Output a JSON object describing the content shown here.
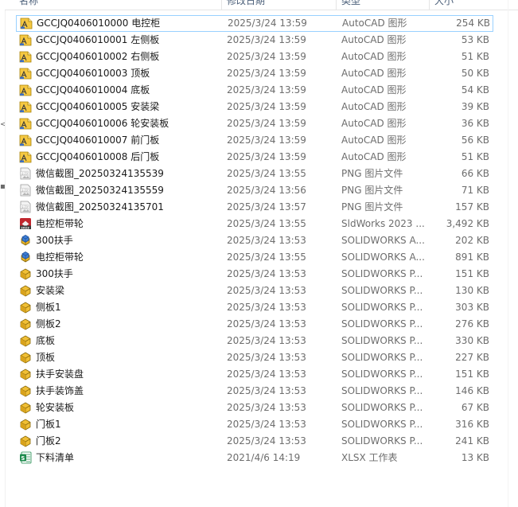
{
  "header": {
    "name": "名称",
    "date": "修改日期",
    "type": "类型",
    "size": "大小"
  },
  "nav_glyphs": [
    {
      "symbol": "<"
    },
    {
      "symbol": "▪"
    }
  ],
  "files": [
    {
      "name": "GCCJQ0406010000 电控柜",
      "date": "2025/3/24 13:59",
      "type": "AutoCAD 图形",
      "size": "254 KB",
      "icon": "dwg-file-icon",
      "selected": true
    },
    {
      "name": "GCCJQ0406010001 左侧板",
      "date": "2025/3/24 13:59",
      "type": "AutoCAD 图形",
      "size": "53 KB",
      "icon": "dwg-file-icon"
    },
    {
      "name": "GCCJQ0406010002 右侧板",
      "date": "2025/3/24 13:59",
      "type": "AutoCAD 图形",
      "size": "51 KB",
      "icon": "dwg-file-icon"
    },
    {
      "name": "GCCJQ0406010003 顶板",
      "date": "2025/3/24 13:59",
      "type": "AutoCAD 图形",
      "size": "50 KB",
      "icon": "dwg-file-icon"
    },
    {
      "name": "GCCJQ0406010004 底板",
      "date": "2025/3/24 13:59",
      "type": "AutoCAD 图形",
      "size": "54 KB",
      "icon": "dwg-file-icon"
    },
    {
      "name": "GCCJQ0406010005 安装梁",
      "date": "2025/3/24 13:59",
      "type": "AutoCAD 图形",
      "size": "39 KB",
      "icon": "dwg-file-icon"
    },
    {
      "name": "GCCJQ0406010006 轮安装板",
      "date": "2025/3/24 13:59",
      "type": "AutoCAD 图形",
      "size": "36 KB",
      "icon": "dwg-file-icon"
    },
    {
      "name": "GCCJQ0406010007 前门板",
      "date": "2025/3/24 13:59",
      "type": "AutoCAD 图形",
      "size": "56 KB",
      "icon": "dwg-file-icon"
    },
    {
      "name": "GCCJQ0406010008 后门板",
      "date": "2025/3/24 13:59",
      "type": "AutoCAD 图形",
      "size": "51 KB",
      "icon": "dwg-file-icon"
    },
    {
      "name": "微信截图_20250324135539",
      "date": "2025/3/24 13:55",
      "type": "PNG 图片文件",
      "size": "66 KB",
      "icon": "png-file-icon"
    },
    {
      "name": "微信截图_20250324135559",
      "date": "2025/3/24 13:56",
      "type": "PNG 图片文件",
      "size": "71 KB",
      "icon": "png-file-icon"
    },
    {
      "name": "微信截图_20250324135701",
      "date": "2025/3/24 13:57",
      "type": "PNG 图片文件",
      "size": "157 KB",
      "icon": "png-file-icon"
    },
    {
      "name": "电控柜带轮",
      "date": "2025/3/24 13:55",
      "type": "SldWorks 2023 ...",
      "size": "3,492 KB",
      "icon": "sldworks-2023-icon"
    },
    {
      "name": "300扶手",
      "date": "2025/3/24 13:53",
      "type": "SOLIDWORKS A...",
      "size": "202 KB",
      "icon": "assembly-file-icon"
    },
    {
      "name": "电控柜带轮",
      "date": "2025/3/24 13:55",
      "type": "SOLIDWORKS A...",
      "size": "891 KB",
      "icon": "assembly-file-icon"
    },
    {
      "name": "300扶手",
      "date": "2025/3/24 13:53",
      "type": "SOLIDWORKS P...",
      "size": "151 KB",
      "icon": "part-file-icon"
    },
    {
      "name": "安装梁",
      "date": "2025/3/24 13:53",
      "type": "SOLIDWORKS P...",
      "size": "130 KB",
      "icon": "part-file-icon"
    },
    {
      "name": "侧板1",
      "date": "2025/3/24 13:53",
      "type": "SOLIDWORKS P...",
      "size": "303 KB",
      "icon": "part-file-icon"
    },
    {
      "name": "侧板2",
      "date": "2025/3/24 13:53",
      "type": "SOLIDWORKS P...",
      "size": "276 KB",
      "icon": "part-file-icon"
    },
    {
      "name": "底板",
      "date": "2025/3/24 13:53",
      "type": "SOLIDWORKS P...",
      "size": "330 KB",
      "icon": "part-file-icon"
    },
    {
      "name": "顶板",
      "date": "2025/3/24 13:53",
      "type": "SOLIDWORKS P...",
      "size": "227 KB",
      "icon": "part-file-icon"
    },
    {
      "name": "扶手安装盘",
      "date": "2025/3/24 13:53",
      "type": "SOLIDWORKS P...",
      "size": "151 KB",
      "icon": "part-file-icon"
    },
    {
      "name": "扶手装饰盖",
      "date": "2025/3/24 13:53",
      "type": "SOLIDWORKS P...",
      "size": "146 KB",
      "icon": "part-file-icon"
    },
    {
      "name": "轮安装板",
      "date": "2025/3/24 13:53",
      "type": "SOLIDWORKS P...",
      "size": "67 KB",
      "icon": "part-file-icon"
    },
    {
      "name": "门板1",
      "date": "2025/3/24 13:53",
      "type": "SOLIDWORKS P...",
      "size": "316 KB",
      "icon": "part-file-icon"
    },
    {
      "name": "门板2",
      "date": "2025/3/24 13:53",
      "type": "SOLIDWORKS P...",
      "size": "241 KB",
      "icon": "part-file-icon"
    },
    {
      "name": "下料清单",
      "date": "2021/4/6 14:19",
      "type": "XLSX 工作表",
      "size": "13 KB",
      "icon": "xlsx-file-icon"
    }
  ],
  "colors": {
    "selection_border": "#99d1ff",
    "dwg_icon": "#f2c12e",
    "part_icon": "#e8b427",
    "assembly_blue": "#3d7fd6",
    "sldworks_red": "#c0262d",
    "xlsx_green": "#1d8a4c",
    "png_gray": "#b9b9b9"
  }
}
